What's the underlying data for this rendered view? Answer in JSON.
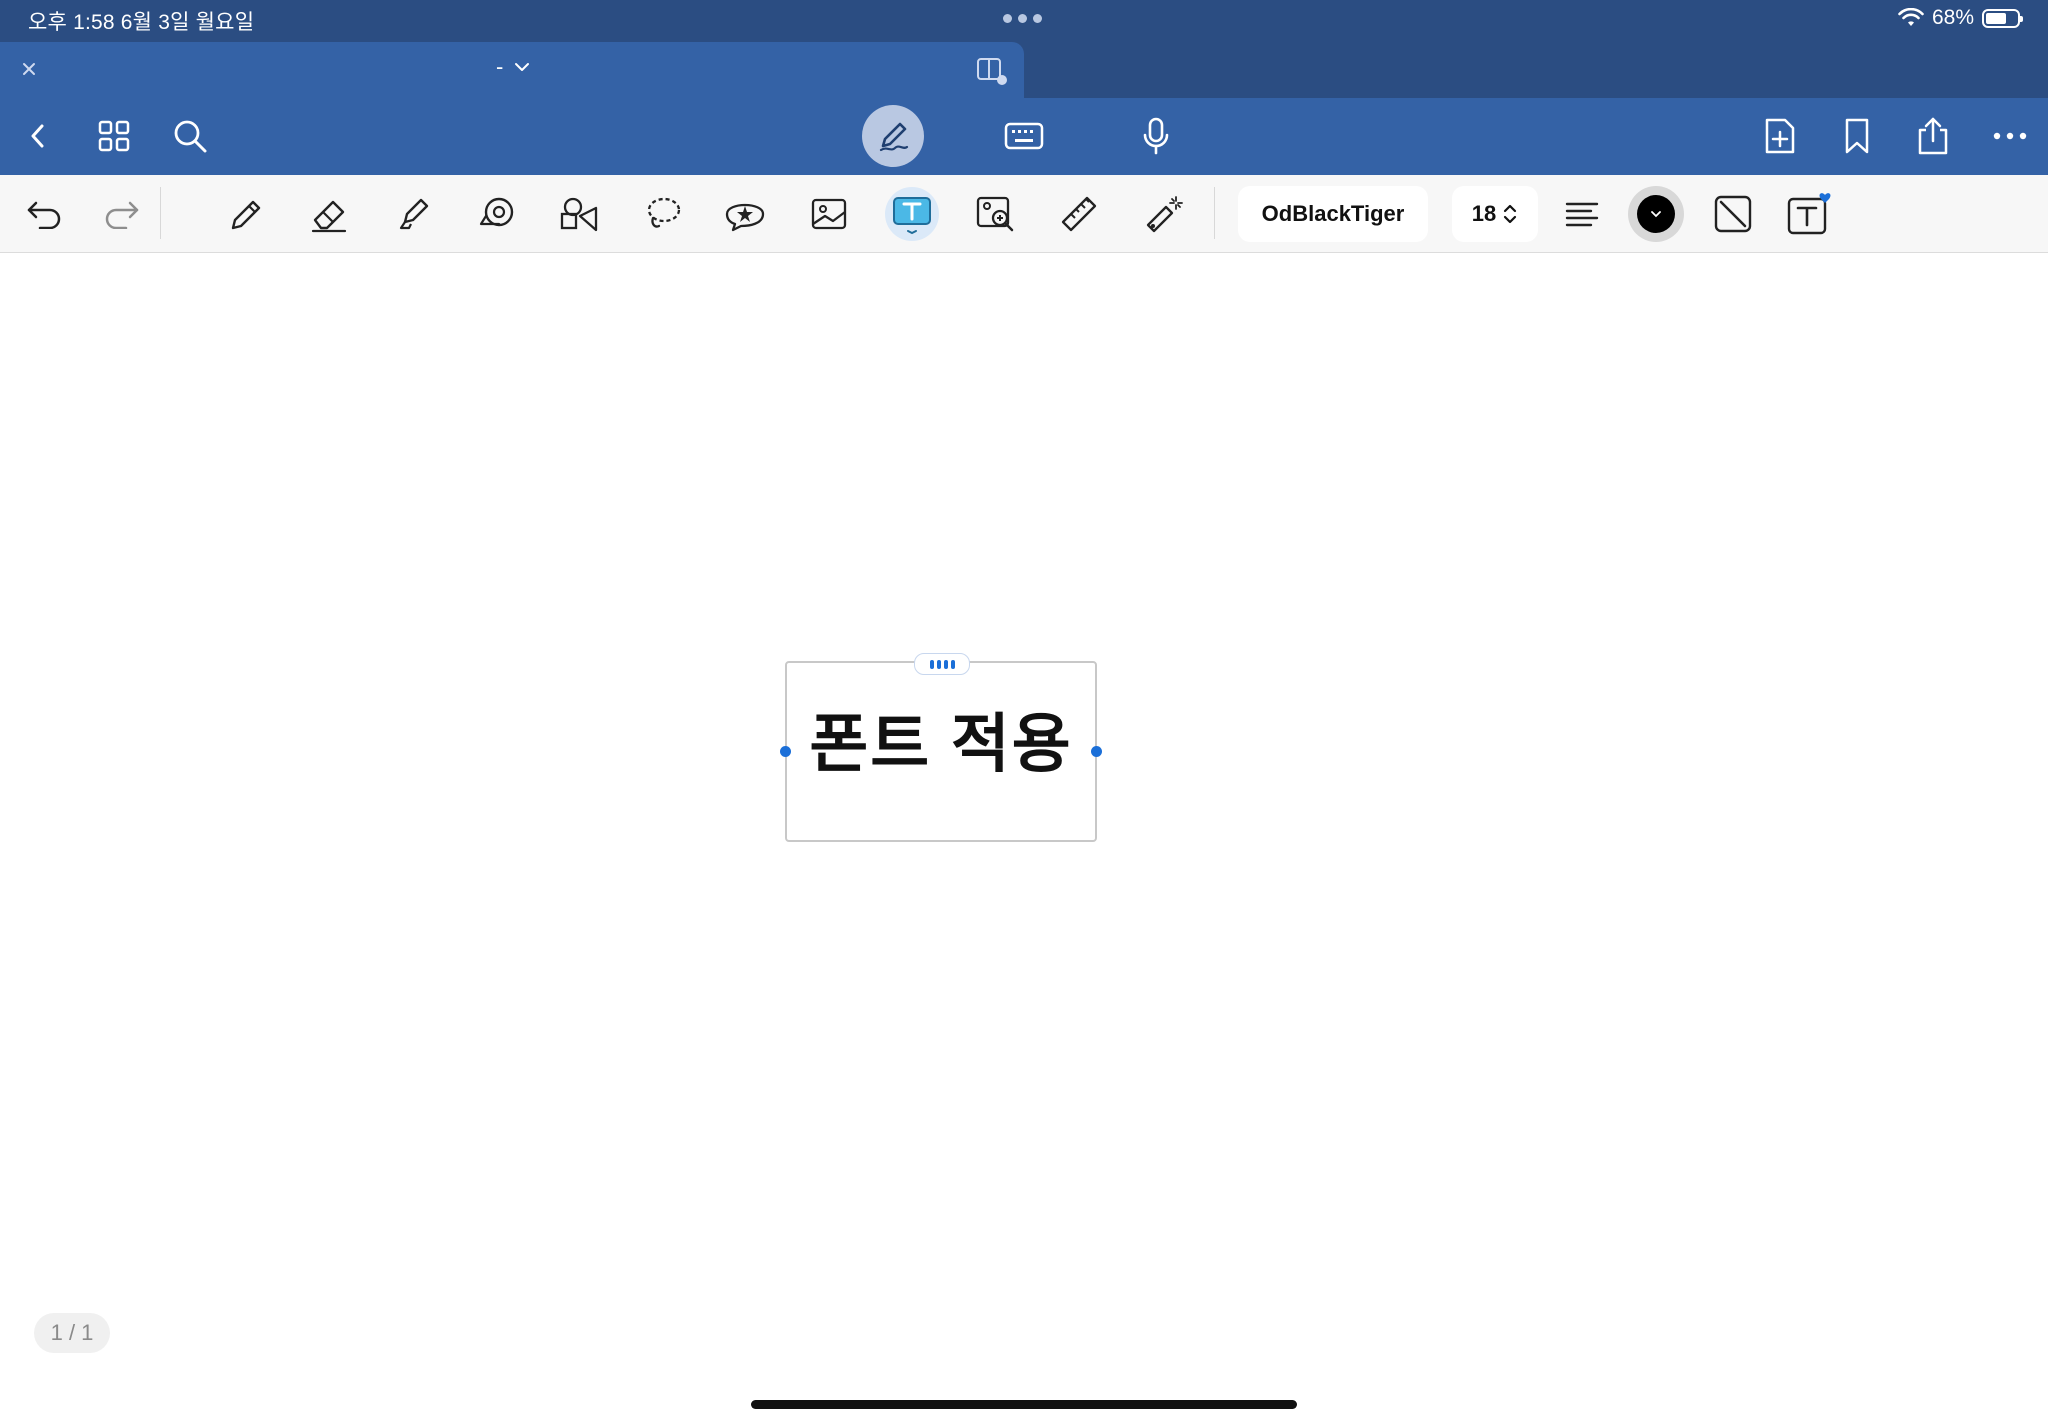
{
  "status_bar": {
    "time_date": "오후 1:58   6월 3일 월요일",
    "battery": "68%"
  },
  "window": {
    "title": "-",
    "tab_close_icon": "close-icon",
    "dropdown_icon": "chevron-down-icon",
    "split_view_icon": "split-view-icon"
  },
  "app_toolbar": {
    "left_icons": [
      "back-icon",
      "grid-icon",
      "search-icon"
    ],
    "center_icons": [
      "pen-write-icon",
      "keyboard-icon",
      "microphone-icon"
    ],
    "right_icons": [
      "add-page-icon",
      "bookmark-icon",
      "share-icon",
      "more-icon"
    ]
  },
  "draw_toolbar": {
    "tools": [
      "undo-icon",
      "redo-icon",
      "pencil-icon",
      "eraser-icon",
      "highlighter-icon",
      "tape-icon",
      "shapes-icon",
      "lasso-icon",
      "sticker-icon",
      "image-icon",
      "text-box-icon",
      "image-search-icon",
      "ruler-icon",
      "laser-pointer-icon"
    ],
    "active_tool": "text-box-icon",
    "font_name": "OdBlackTiger",
    "font_size": "18",
    "align_icon": "align-left-icon",
    "text_color": "#000000",
    "accent_color": "#1b6fd8"
  },
  "canvas": {
    "text_box": "폰트 적용"
  },
  "page_indicator": "1 / 1"
}
